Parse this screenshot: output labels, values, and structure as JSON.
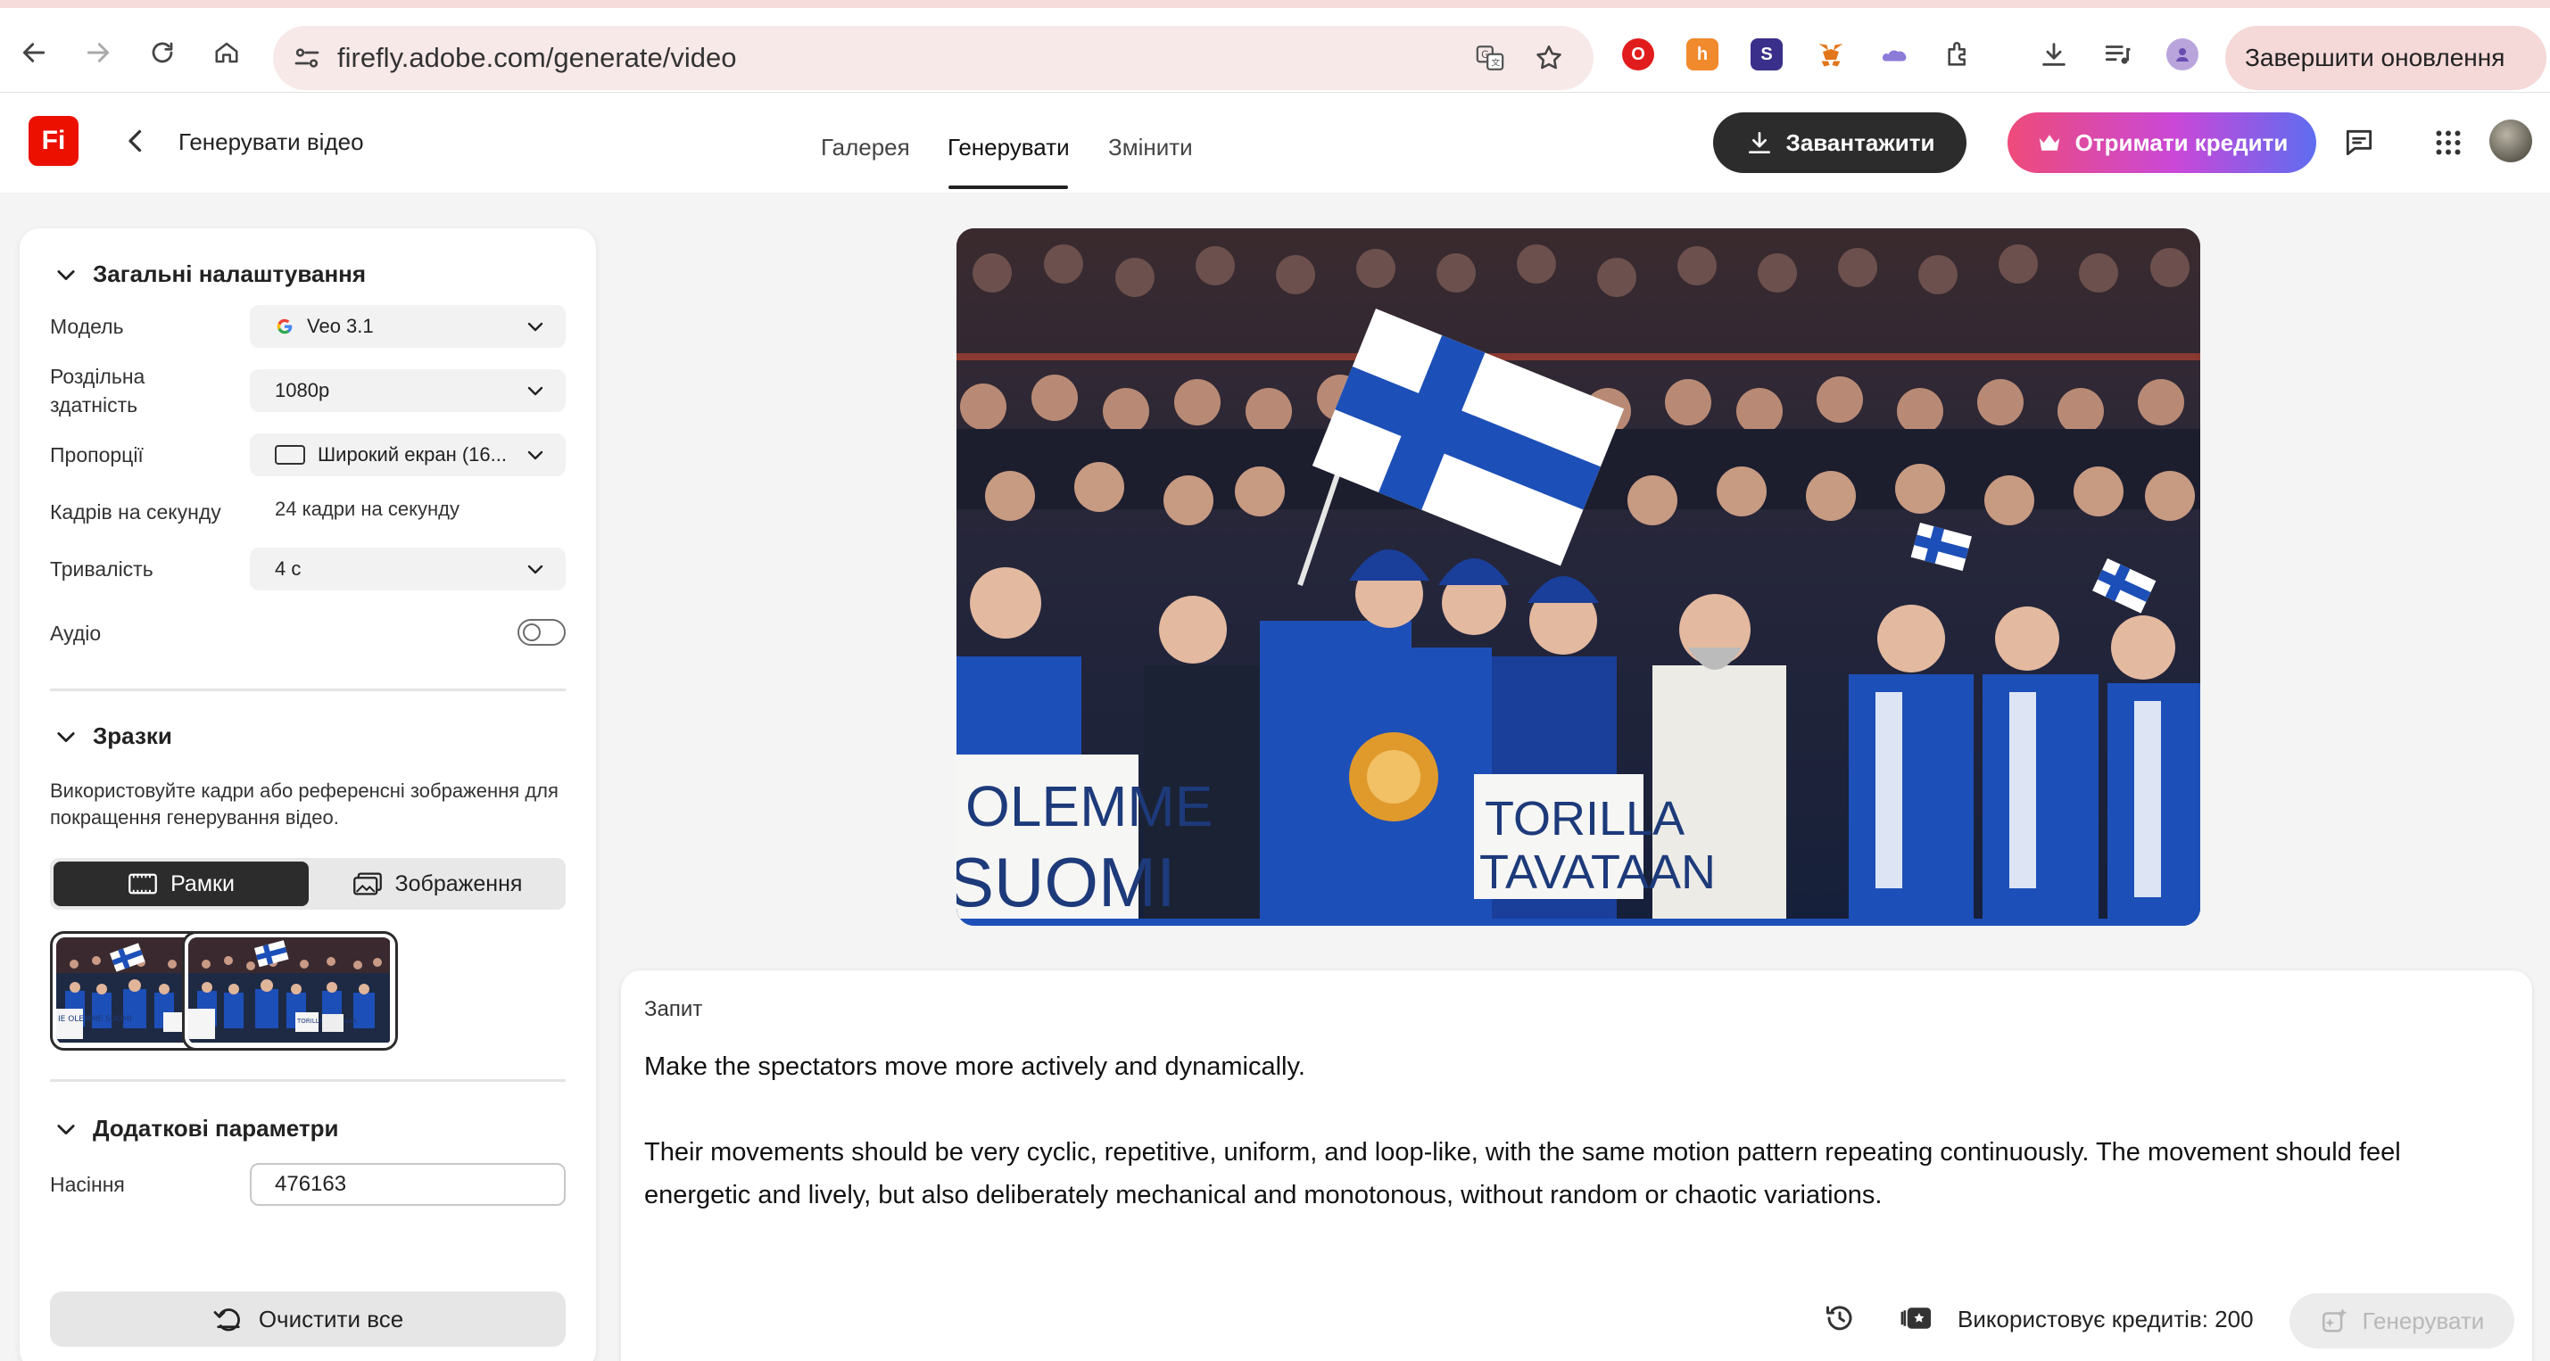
{
  "browser": {
    "url": "firefly.adobe.com/generate/video",
    "update_button": "Завершити оновлення"
  },
  "app": {
    "logo": "Fi",
    "page_title": "Генерувати відео",
    "tabs": [
      {
        "label": "Галерея",
        "active": false
      },
      {
        "label": "Генерувати",
        "active": true
      },
      {
        "label": "Змінити",
        "active": false
      }
    ],
    "download_button": "Завантажити",
    "credits_button": "Отримати кредити"
  },
  "general_settings": {
    "title": "Загальні налаштування",
    "model_label": "Модель",
    "model_value": "Veo 3.1",
    "resolution_label_line1": "Роздільна",
    "resolution_label_line2": "здатність",
    "resolution_value": "1080p",
    "aspect_label": "Пропорції",
    "aspect_value": "Широкий екран (16...",
    "fps_label": "Кадрів на секунду",
    "fps_value": "24 кадри на секунду",
    "duration_label": "Тривалість",
    "duration_value": "4 с",
    "audio_label": "Аудіо",
    "audio_on": false
  },
  "samples": {
    "title": "Зразки",
    "description": "Використовуйте кадри або референсні зображення для покращення генерування відео.",
    "frames_tab": "Рамки",
    "images_tab": "Зображення",
    "thumb_text_left": "IE OLEMME SUOMI",
    "thumb_text_right": "TORILLA TAVATAAN"
  },
  "advanced": {
    "title": "Додаткові параметри",
    "seed_label": "Насіння",
    "seed_value": "476163"
  },
  "clear_button": "Очистити все",
  "preview": {
    "sign_left_line1": "OLEMME",
    "sign_left_line2": "SUOMI",
    "sign_right_line1": "TORILLA",
    "sign_right_line2": "TAVATAAN"
  },
  "prompt": {
    "label": "Запит",
    "text": "Make the spectators move more actively and dynamically.\n\nTheir movements should be very cyclic, repetitive, uniform, and loop-like, with the same motion pattern repeating continuously. The movement should feel energetic and lively, but also deliberately mechanical and monotonous, without random or chaotic variations.",
    "credits_text": "Використовує кредитів: 200",
    "generate_button": "Генерувати"
  },
  "colors": {
    "accent_dark": "#2c2c2c",
    "adobe_red": "#eb1000",
    "credits_gradient_start": "#ee4b7a",
    "credits_gradient_end": "#5e6df0",
    "finland_blue": "#1d4fb8"
  },
  "icons": [
    "back-arrow-icon",
    "forward-arrow-icon",
    "reload-icon",
    "home-icon",
    "site-settings-icon",
    "translate-icon",
    "bookmark-star-icon",
    "download-icon",
    "media-icon",
    "chevron-left-icon",
    "chevron-down-icon",
    "crown-icon",
    "chat-icon",
    "apps-grid-icon",
    "frame-icon",
    "image-icon",
    "reset-icon",
    "history-icon",
    "credits-icon",
    "sparkle-icon"
  ]
}
